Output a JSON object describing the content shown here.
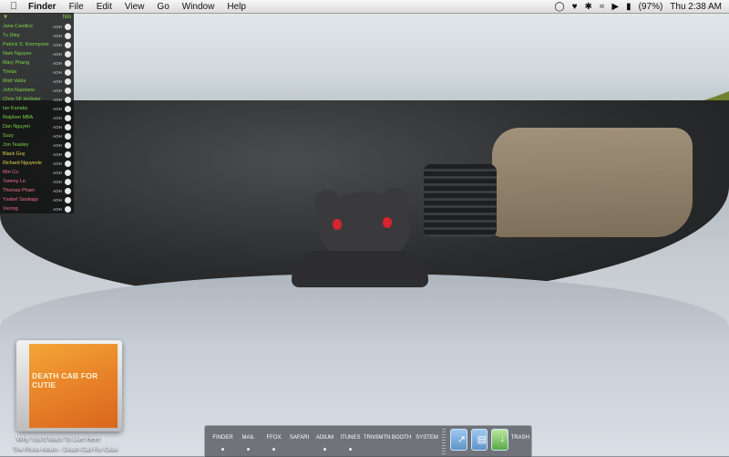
{
  "menubar": {
    "apple_icon": "apple-icon",
    "app_name": "Finder",
    "menus": [
      "File",
      "Edit",
      "View",
      "Go",
      "Window",
      "Help"
    ],
    "status_icons": [
      "chat-bubble-icon",
      "heart-icon",
      "bluetooth-icon",
      "wifi-icon",
      "volume-icon"
    ],
    "battery": "(97%)",
    "clock": "Thu 2:38 AM"
  },
  "buddy_list": {
    "group_name": "hilo",
    "buddies": [
      {
        "name": "Jane Candice",
        "tag": "AOH",
        "status": "online"
      },
      {
        "name": "Tu Diep",
        "tag": "AOH",
        "status": "online"
      },
      {
        "name": "Patrick S. Koompone",
        "tag": "AOH",
        "status": "online"
      },
      {
        "name": "Nam Nguyen",
        "tag": "AOH",
        "status": "online"
      },
      {
        "name": "Mary Phang",
        "tag": "AOH",
        "status": "online"
      },
      {
        "name": "Theda",
        "tag": "AOH",
        "status": "online"
      },
      {
        "name": "Matt Valda",
        "tag": "AOH",
        "status": "online"
      },
      {
        "name": "John Napdane",
        "tag": "AOH",
        "status": "online"
      },
      {
        "name": "Chris SF Hollister",
        "tag": "AOH",
        "status": "online"
      },
      {
        "name": "Ian Kanaby",
        "tag": "AOH",
        "status": "online"
      },
      {
        "name": "Ralphen MBA",
        "tag": "AOH",
        "status": "online"
      },
      {
        "name": "Dan Nguyen",
        "tag": "AOH",
        "status": "online"
      },
      {
        "name": "Suzy",
        "tag": "AOH",
        "status": "online"
      },
      {
        "name": "Jon Teasley",
        "tag": "AOH",
        "status": "online"
      },
      {
        "name": "Black Guy",
        "tag": "AOH",
        "status": "idle"
      },
      {
        "name": "Richard Nguyenle",
        "tag": "AOH",
        "status": "idle"
      },
      {
        "name": "Min Co",
        "tag": "AOH",
        "status": "away"
      },
      {
        "name": "Tammy Le",
        "tag": "AOH",
        "status": "away"
      },
      {
        "name": "Thomas Pham",
        "tag": "AOH",
        "status": "away"
      },
      {
        "name": "Ysabel Santiago",
        "tag": "AOH",
        "status": "away"
      },
      {
        "name": "Vuiong",
        "tag": "AOH",
        "status": "away"
      }
    ]
  },
  "now_playing": {
    "album_art_text": "DEATH CAB FOR CUTIE",
    "song": "Why You'd Want To Live Here",
    "album_artist": "The Photo Album - Death Cab For Cutie"
  },
  "dock": {
    "apps": [
      {
        "label": "FINDER",
        "running": true
      },
      {
        "label": "MAIL",
        "running": true
      },
      {
        "label": "FFOX",
        "running": true
      },
      {
        "label": "SAFARI",
        "running": false
      },
      {
        "label": "ADIUM",
        "running": true
      },
      {
        "label": "ITUNES",
        "running": true
      },
      {
        "label": "TRNSMTN",
        "running": false
      },
      {
        "label": "BOOTH",
        "running": false
      },
      {
        "label": "SYSTEM",
        "running": false
      }
    ],
    "stacks": [
      "applications-stack-icon",
      "documents-stack-icon",
      "downloads-stack-icon"
    ],
    "trash_label": "TRASH"
  },
  "colors": {
    "online": "#7ed447",
    "idle": "#e2d64a",
    "away": "#ef6f8d"
  }
}
